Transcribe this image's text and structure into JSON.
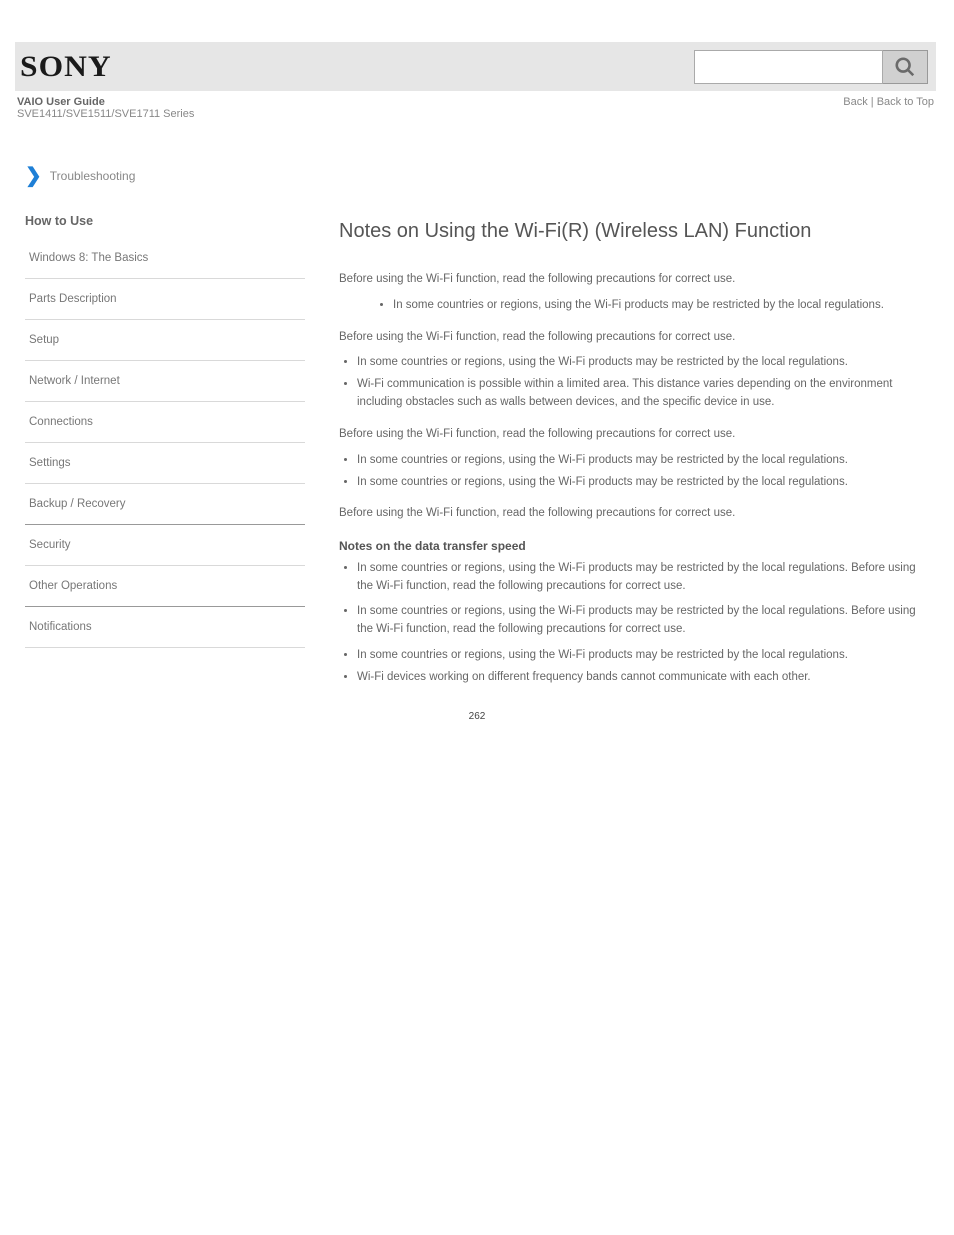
{
  "header": {
    "logo": "SONY",
    "search_placeholder": "",
    "model": "VAIO User Guide",
    "series": "SVE1411/SVE1511/SVE1711 Series",
    "back_to_top": "Back | Back to Top"
  },
  "back_label": "Troubleshooting",
  "sidebar": {
    "title": "How to Use",
    "items": [
      "Windows 8: The Basics",
      "Parts Description",
      "Setup",
      "Network / Internet",
      "Connections",
      "Settings",
      "Backup / Recovery",
      "Security",
      "Other Operations",
      "Notifications"
    ]
  },
  "main": {
    "title": "Notes on Using the Wi-Fi(R) (Wireless LAN) Function",
    "p1": "Before using the Wi-Fi function, read the following precautions for correct use.",
    "bullets1": [
      "In some countries or regions, using the Wi-Fi products may be restricted by the local regulations."
    ],
    "p2": "Before using the Wi-Fi function, read the following precautions for correct use.",
    "notes1_a": "In some countries or regions, using the Wi-Fi products may be restricted by the local regulations.",
    "notes1_b": "Wi-Fi communication is possible within a limited area. This distance varies depending on the environment including obstacles such as walls between devices, and the specific device in use.",
    "p3": "Before using the Wi-Fi function, read the following precautions for correct use.",
    "bullets2": [
      "In some countries or regions, using the Wi-Fi products may be restricted by the local regulations.",
      "In some countries or regions, using the Wi-Fi products may be restricted by the local regulations."
    ],
    "p4": "Before using the Wi-Fi function, read the following precautions for correct use.",
    "h_notes": "Notes on the data transfer speed",
    "notes2_a": "In some countries or regions, using the Wi-Fi products may be restricted by the local regulations. Before using the Wi-Fi function, read the following precautions for correct use.",
    "notes2_b": "In some countries or regions, using the Wi-Fi products may be restricted by the local regulations. Before using the Wi-Fi function, read the following precautions for correct use.",
    "notes2_c": "In some countries or regions, using the Wi-Fi products may be restricted by the local regulations.",
    "notes2_d": "Wi-Fi devices working on different frequency bands cannot communicate with each other."
  },
  "page_number": "262"
}
